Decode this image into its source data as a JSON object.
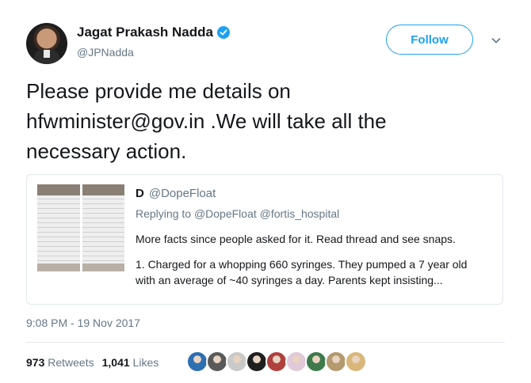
{
  "author": {
    "name": "Jagat Prakash Nadda",
    "handle": "@JPNadda",
    "verified": true,
    "avatar_icon": "profile-photo"
  },
  "follow_label": "Follow",
  "menu_icon": "chevron-down-icon",
  "tweet": {
    "lines": [
      "Please provide me details on",
      "hfwminister@gov.in .We will take all the",
      "necessary action."
    ]
  },
  "quoted": {
    "name": "D",
    "handle": "@DopeFloat",
    "reply_prefix": "Replying to",
    "reply_to": [
      "@DopeFloat",
      "@fortis_hospital"
    ],
    "paragraph1": "More facts since people asked for it. Read thread and see snaps.",
    "paragraph2_line1": "1. Charged for a whopping 660 syringes. They pumped a 7 year old",
    "paragraph2_line2": "with an average of ~40 syringes a day. Parents kept insisting..."
  },
  "timestamp": "9:08 PM - 19 Nov 2017",
  "stats": {
    "retweets_count": "973",
    "retweets_label": "Retweets",
    "likes_count": "1,041",
    "likes_label": "Likes"
  },
  "likers": [
    {
      "color": "#2d6fb0"
    },
    {
      "color": "#5a5a5a"
    },
    {
      "color": "#c9c9c9"
    },
    {
      "color": "#1f1f1f"
    },
    {
      "color": "#b0413e"
    },
    {
      "color": "#e0c9d8"
    },
    {
      "color": "#3e7a4b"
    },
    {
      "color": "#b49a6e"
    },
    {
      "color": "#d9b77a"
    }
  ]
}
